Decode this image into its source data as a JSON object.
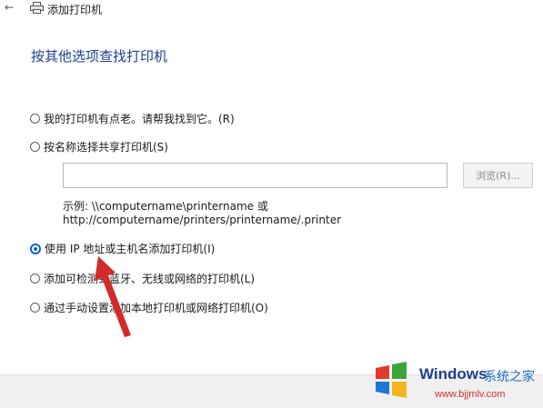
{
  "window": {
    "title": "添加打印机",
    "back_icon": "back-arrow-icon",
    "printer_icon": "printer-icon"
  },
  "heading": "按其他选项查找打印机",
  "options": [
    {
      "label": "我的打印机有点老。请帮我找到它。(R)",
      "checked": false
    },
    {
      "label": "按名称选择共享打印机(S)",
      "checked": false
    },
    {
      "label": "使用 IP 地址或主机名添加打印机(I)",
      "checked": true
    },
    {
      "label": "添加可检测到蓝牙、无线或网络的打印机(L)",
      "checked": false
    },
    {
      "label": "通过手动设置添加本地打印机或网络打印机(O)",
      "checked": false
    }
  ],
  "shared_printer": {
    "input_value": "",
    "browse_label": "浏览(R)...",
    "example_line1": "示例: \\\\computername\\printername 或",
    "example_line2": "http://computername/printers/printername/.printer"
  },
  "colors": {
    "heading": "#1c3f94",
    "accent": "#0a64c8",
    "annotation_arrow": "#d42a2a"
  },
  "watermark": {
    "brand": "Windows",
    "site_name": "系统之家",
    "url": "www.bjjmlv.com"
  }
}
